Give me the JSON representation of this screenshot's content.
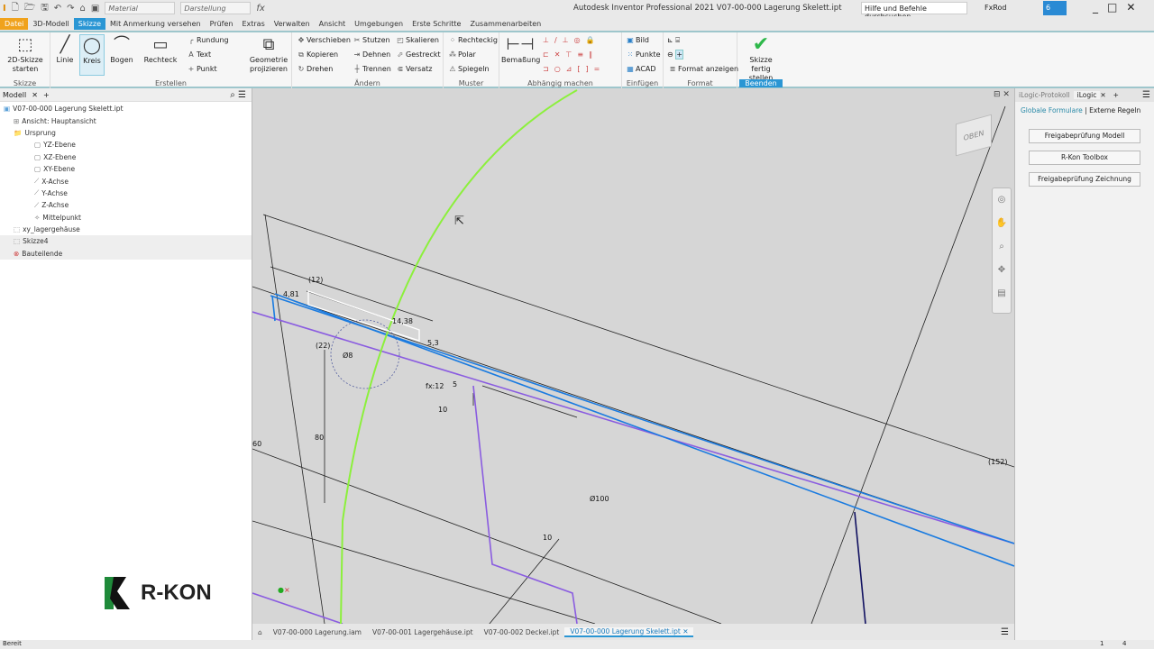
{
  "titlebar": {
    "app_title": "Autodesk Inventor Professional 2021   V07-00-000 Lagerung Skelett.ipt",
    "material": "Material",
    "appearance": "Darstellung",
    "search_placeholder": "Hilfe und Befehle durchsuchen...",
    "user": "FxRod",
    "notifications": "6"
  },
  "ribbon_tabs": [
    "Datei",
    "3D-Modell",
    "Skizze",
    "Mit Anmerkung versehen",
    "Prüfen",
    "Extras",
    "Verwalten",
    "Ansicht",
    "Umgebungen",
    "Erste Schritte",
    "Zusammenarbeiten"
  ],
  "active_tab": "Skizze",
  "ribbon": {
    "skizze": {
      "title": "Skizze",
      "start": "2D-Skizze starten"
    },
    "erstellen": {
      "title": "Erstellen",
      "linie": "Linie",
      "kreis": "Kreis",
      "bogen": "Bogen",
      "rechteck": "Rechteck",
      "rundung": "Rundung",
      "text": "Text",
      "punkt": "Punkt"
    },
    "projizieren": "Geometrie projizieren",
    "aendern": {
      "title": "Ändern",
      "items": [
        "Verschieben",
        "Kopieren",
        "Drehen",
        "Stutzen",
        "Dehnen",
        "Trennen",
        "Skalieren",
        "Gestreckt",
        "Versatz"
      ]
    },
    "muster": {
      "title": "Muster",
      "items": [
        "Rechteckig",
        "Polar",
        "Spiegeln"
      ]
    },
    "abhaengig": {
      "title": "Abhängig machen",
      "bemassung": "Bemaßung"
    },
    "einfuegen": {
      "title": "Einfügen",
      "items": [
        "Bild",
        "Punkte",
        "ACAD"
      ]
    },
    "format": {
      "title": "Format",
      "anzeigen": "Format anzeigen"
    },
    "beenden": {
      "title": "Beenden",
      "finish": "Skizze fertig stellen"
    }
  },
  "browser": {
    "tab": "Modell",
    "nodes": [
      {
        "label": "V07-00-000 Lagerung Skelett.ipt",
        "level": 0
      },
      {
        "label": "Ansicht: Hauptansicht",
        "level": 1
      },
      {
        "label": "Ursprung",
        "level": 1
      },
      {
        "label": "YZ-Ebene",
        "level": 2
      },
      {
        "label": "XZ-Ebene",
        "level": 2
      },
      {
        "label": "XY-Ebene",
        "level": 2
      },
      {
        "label": "X-Achse",
        "level": 2
      },
      {
        "label": "Y-Achse",
        "level": 2
      },
      {
        "label": "Z-Achse",
        "level": 2
      },
      {
        "label": "Mittelpunkt",
        "level": 2
      },
      {
        "label": "xy_lagergehäuse",
        "level": 1
      },
      {
        "label": "Skizze4",
        "level": 1
      },
      {
        "label": "Bauteilende",
        "level": 1
      }
    ]
  },
  "logo": "R-KON",
  "viewcube": "OBEN",
  "dimensions": [
    "(12)",
    "4,81",
    "14,38",
    "5,3",
    "(22)",
    "Ø8",
    "fx:12",
    "5",
    "10",
    "80",
    "60",
    "Ø100",
    "10",
    "(152)"
  ],
  "right_panel": {
    "tabs": [
      "iLogic-Protokoll",
      "iLogic"
    ],
    "subtabs": [
      "Globale Formulare",
      "Externe Regeln"
    ],
    "buttons": [
      "Freigabeprüfung Modell",
      "R-Kon Toolbox",
      "Freigabeprüfung Zeichnung"
    ]
  },
  "doc_tabs": [
    "V07-00-000 Lagerung.iam",
    "V07-00-001 Lagergehäuse.ipt",
    "V07-00-002 Deckel.ipt",
    "V07-00-000 Lagerung Skelett.ipt"
  ],
  "status": {
    "text": "Bereit",
    "n1": "1",
    "n2": "4"
  },
  "colors": {
    "accent": "#2a96d4",
    "file_tab": "#f0a21c",
    "sketch_blue": "#1a7be0",
    "sketch_purple": "#8a5ce0",
    "curve_green": "#8cf03c"
  }
}
